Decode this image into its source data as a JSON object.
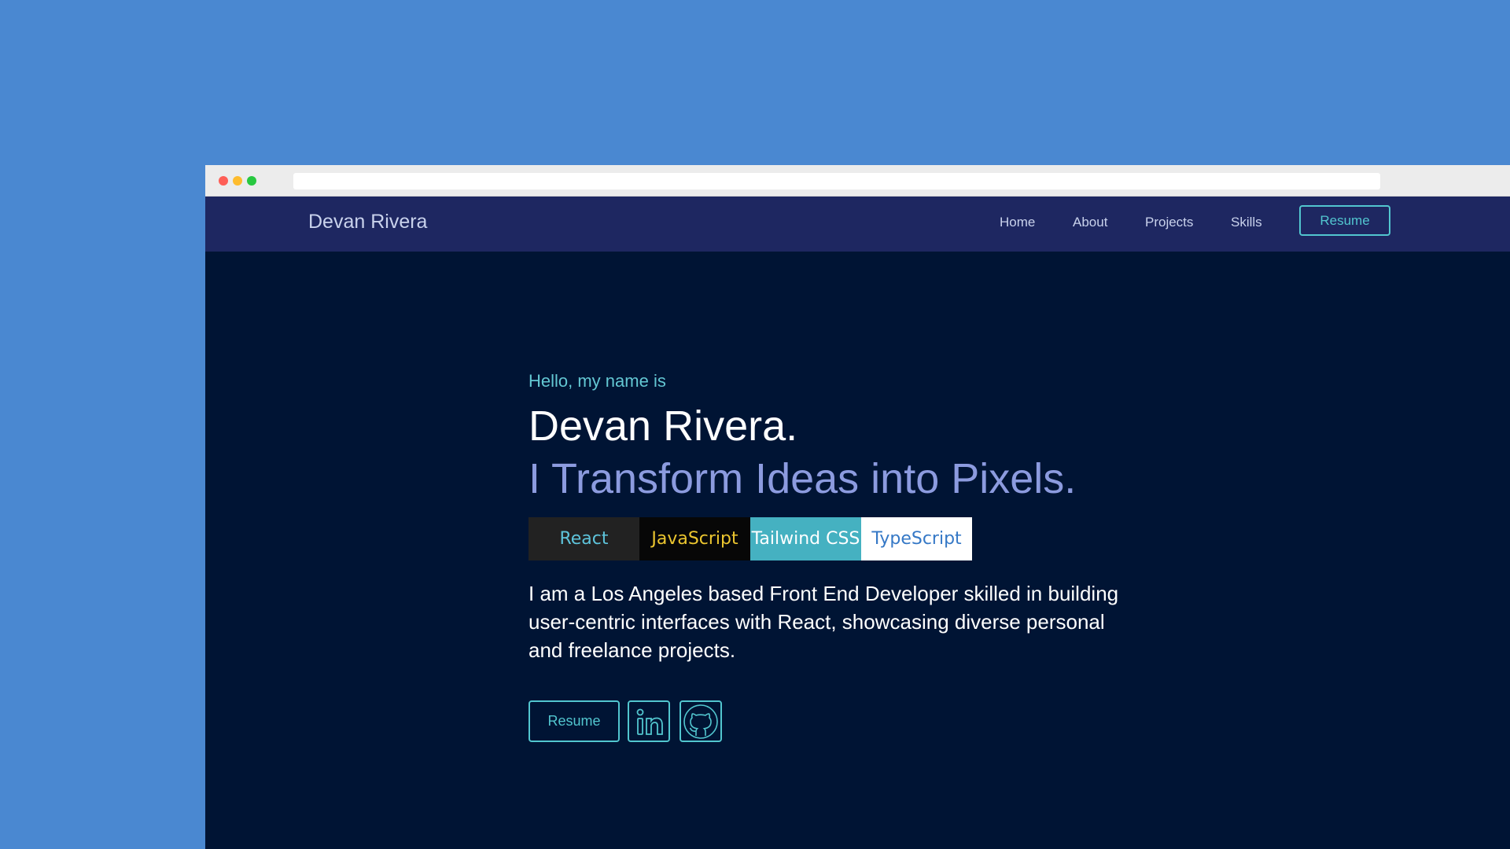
{
  "navbar": {
    "brand": "Devan Rivera",
    "links": [
      "Home",
      "About",
      "Projects",
      "Skills"
    ],
    "resume_label": "Resume"
  },
  "hero": {
    "greeting": "Hello, my name is",
    "name": "Devan Rivera.",
    "tagline": "I Transform Ideas into Pixels.",
    "tech": [
      "React",
      "JavaScript",
      "Tailwind CSS",
      "TypeScript"
    ],
    "bio": "I am a Los Angeles based Front End Developer skilled in building user-centric interfaces with React, showcasing diverse personal and freelance projects.",
    "resume_label": "Resume"
  },
  "colors": {
    "desktop": "#4a88d1",
    "page_bg": "#001434",
    "navbar_bg": "#1e2761",
    "accent": "#52c6cf",
    "tagline": "#8c9bdf"
  },
  "icons": {
    "linkedin": "linkedin-icon",
    "github": "github-icon"
  }
}
